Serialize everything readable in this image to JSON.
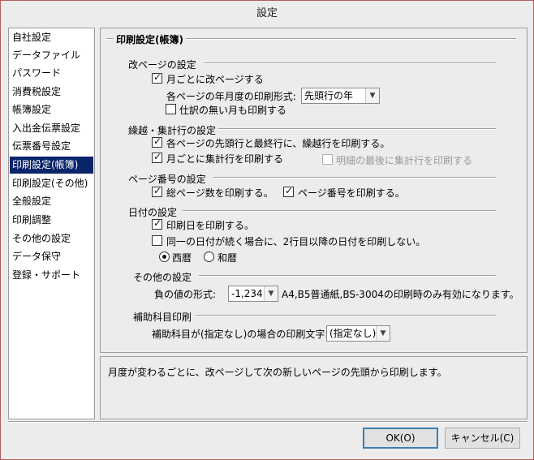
{
  "window": {
    "title": "設定"
  },
  "sidebar": {
    "items": [
      {
        "label": "自社設定"
      },
      {
        "label": "データファイル"
      },
      {
        "label": "パスワード"
      },
      {
        "label": "消費税設定"
      },
      {
        "label": "帳簿設定"
      },
      {
        "label": "入出金伝票設定"
      },
      {
        "label": "伝票番号設定"
      },
      {
        "label": "印刷設定(帳簿)",
        "selected": true
      },
      {
        "label": "印刷設定(その他)"
      },
      {
        "label": "全般設定"
      },
      {
        "label": "印刷調整"
      },
      {
        "label": "その他の設定"
      },
      {
        "label": "データ保守"
      },
      {
        "label": "登録・サポート"
      }
    ]
  },
  "panel": {
    "title": "印刷設定(帳簿)",
    "page_break": {
      "title": "改ページの設定",
      "monthly_break": {
        "label": "月ごとに改ページする",
        "checked": true
      },
      "format_label": "各ページの年月度の印刷形式:",
      "format_value": "先頭行の年",
      "print_empty_month": {
        "label": "仕訳の無い月も印刷する",
        "checked": false
      }
    },
    "carryover": {
      "title": "繰越・集計行の設定",
      "print_carry": {
        "label": "各ページの先頭行と最終行に、繰越行を印刷する。",
        "checked": true
      },
      "monthly_total": {
        "label": "月ごとに集計行を印刷する",
        "checked": true
      },
      "detail_last": {
        "label": "明細の最後に集計行を印刷する",
        "checked": false,
        "disabled": true
      }
    },
    "page_number": {
      "title": "ページ番号の設定",
      "total_pages": {
        "label": "総ページ数を印刷する。",
        "checked": true
      },
      "page_num": {
        "label": "ページ番号を印刷する。",
        "checked": true
      }
    },
    "date": {
      "title": "日付の設定",
      "print_date": {
        "label": "印刷日を印刷する。",
        "checked": true
      },
      "same_date": {
        "label": "同一の日付が続く場合に、2行目以降の日付を印刷しない。",
        "checked": false
      },
      "era": [
        {
          "label": "西暦",
          "checked": true
        },
        {
          "label": "和暦",
          "checked": false
        }
      ]
    },
    "other": {
      "title": "その他の設定",
      "negative_label": "負の値の形式:",
      "negative_value": "-1,234",
      "note": "A4,B5普通紙,BS-3004の印刷時のみ有効になります。"
    },
    "sub_account": {
      "title": "補助科目印刷",
      "label": "補助科目が(指定なし)の場合の印刷文字:",
      "value": "(指定なし)"
    }
  },
  "description": "月度が変わるごとに、改ページして次の新しいページの先頭から印刷します。",
  "buttons": {
    "ok": "OK(O)",
    "cancel": "キャンセル(C)"
  }
}
